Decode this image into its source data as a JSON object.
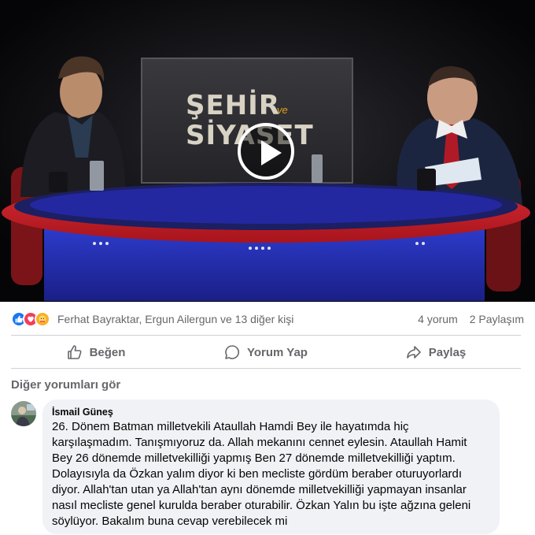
{
  "video": {
    "logo_line1": "ŞEHİR",
    "logo_ve": "ve",
    "logo_line2": "SİYASET"
  },
  "reactions": {
    "icons": [
      "like-icon",
      "love-icon",
      "care-icon"
    ],
    "reactors": "Ferhat Bayraktar, Ergun Ailergun ve 13 diğer kişi",
    "comments_count": "4 yorum",
    "shares_count": "2 Paylaşım"
  },
  "actions": {
    "like": "Beğen",
    "comment": "Yorum Yap",
    "share": "Paylaş"
  },
  "comments": {
    "more_label": "Diğer yorumları gör",
    "items": [
      {
        "author": "İsmail Güneş",
        "text": "26. Dönem Batman milletvekili Ataullah Hamdi Bey ile hayatımda hiç karşılaşmadım. Tanışmıyoruz da. Allah mekanını cennet eylesin. Ataullah Hamit Bey 26 dönemde milletvekilliği yapmış Ben 27 dönemde milletvekilliği yaptım. Dolayısıyla da Özkan yalım diyor ki ben mecliste gördüm beraber oturuyorlardı diyor. Allah'tan utan ya Allah'tan aynı dönemde milletvekilliği yapmayan insanlar nasıl mecliste genel kurulda beraber oturabilir. Özkan Yalın bu işte ağzına geleni söylüyor. Bakalım buna cevap verebilecek mi"
      }
    ]
  },
  "colors": {
    "facebook_blue": "#1877f2",
    "secondary_text": "#65676b",
    "bubble_bg": "#f0f2f5",
    "table_red": "#c9202a"
  }
}
